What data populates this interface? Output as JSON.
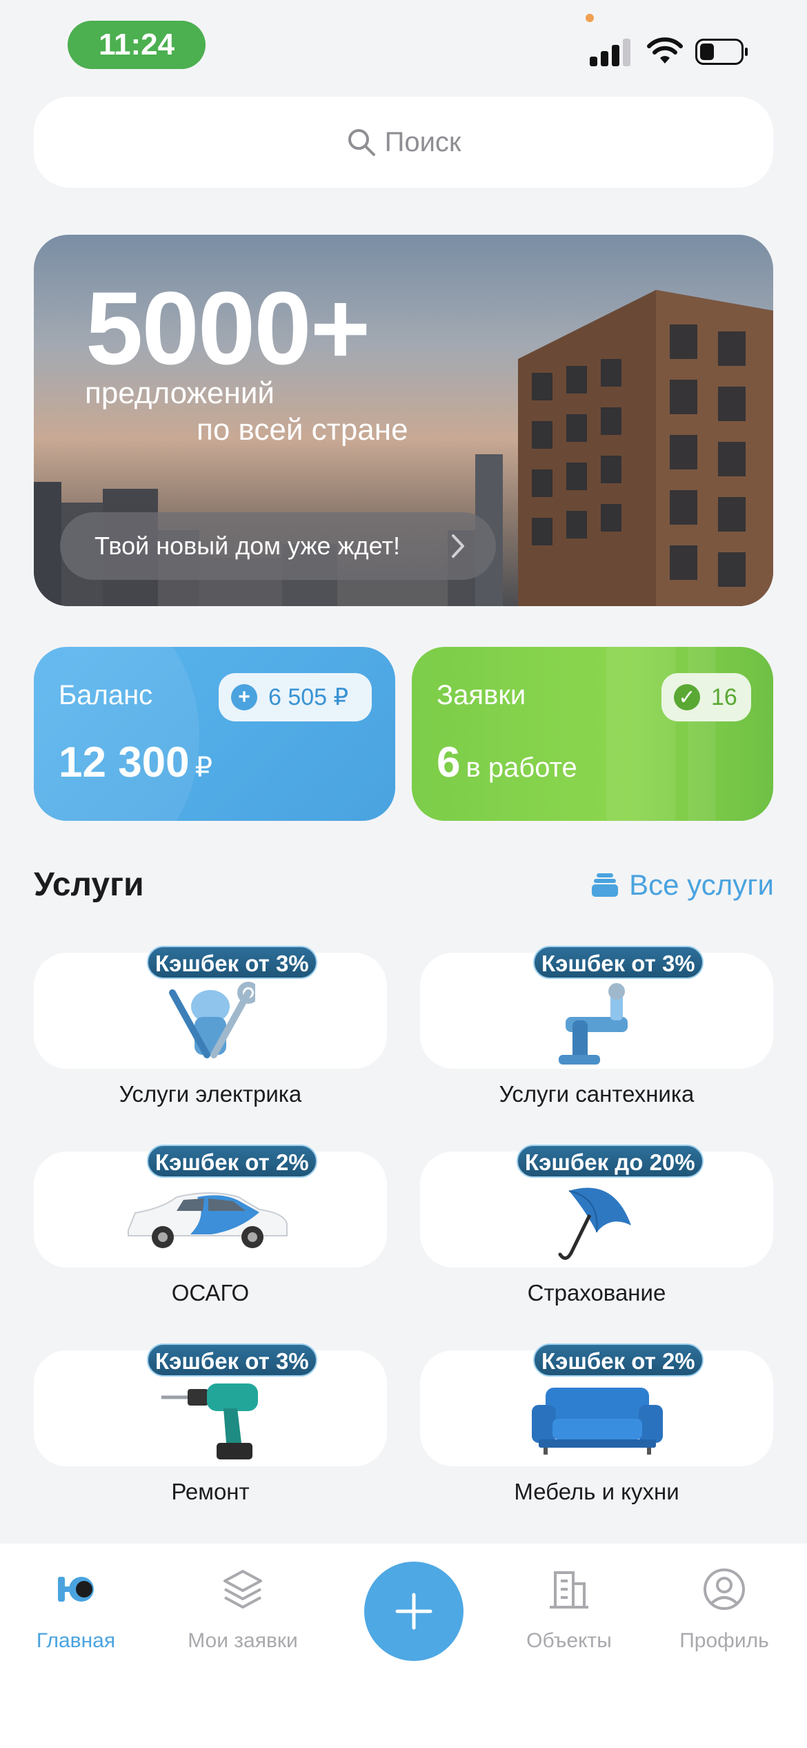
{
  "status_bar": {
    "time": "11:24"
  },
  "search": {
    "placeholder": "Поиск"
  },
  "banner": {
    "headline": "5000+",
    "line1": "предложений",
    "line2": "по всей стране",
    "cta": "Твой новый дом уже ждет!"
  },
  "balance_card": {
    "label": "Баланс",
    "chip_value": "6 505 ₽",
    "amount": "12 300",
    "currency": "₽"
  },
  "orders_card": {
    "label": "Заявки",
    "chip_value": "16",
    "count": "6",
    "count_suffix": "в работе"
  },
  "services": {
    "title": "Услуги",
    "all_link": "Все услуги",
    "items": [
      {
        "label": "Услуги электрика",
        "badge": "Кэшбек от 3%",
        "icon": "electrician-tools-icon"
      },
      {
        "label": "Услуги сантехника",
        "badge": "Кэшбек от 3%",
        "icon": "plumbing-pipe-icon"
      },
      {
        "label": "ОСАГО",
        "badge": "Кэшбек от 2%",
        "icon": "car-icon"
      },
      {
        "label": "Страхование",
        "badge": "Кэшбек до 20%",
        "icon": "umbrella-icon"
      },
      {
        "label": "Ремонт",
        "badge": "Кэшбек от 3%",
        "icon": "drill-icon"
      },
      {
        "label": "Мебель и кухни",
        "badge": "Кэшбек от 2%",
        "icon": "sofa-icon"
      }
    ]
  },
  "bottom_nav": {
    "items": [
      {
        "label": "Главная",
        "active": true
      },
      {
        "label": "Мои заявки",
        "active": false
      },
      {
        "label": "Объекты",
        "active": false
      },
      {
        "label": "Профиль",
        "active": false
      }
    ]
  },
  "colors": {
    "accent": "#4aa3df",
    "green": "#7ccd4a",
    "time_pill": "#4caf50",
    "badge": "#1f5578"
  }
}
